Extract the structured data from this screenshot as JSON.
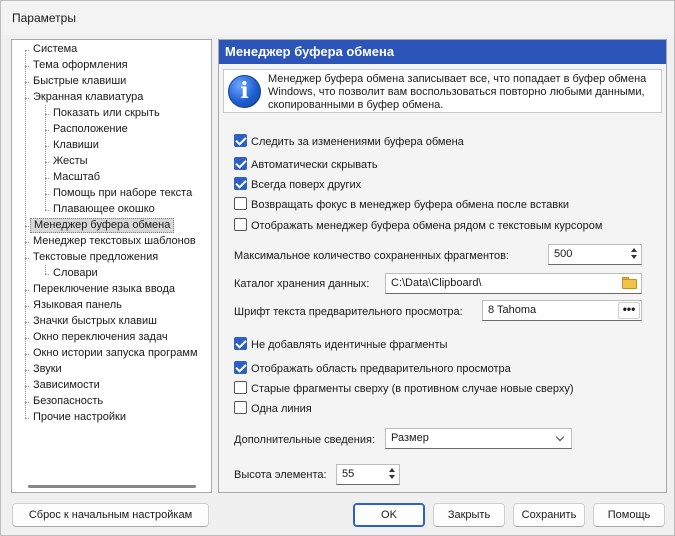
{
  "window": {
    "title": "Параметры"
  },
  "tree": {
    "items": [
      {
        "label": "Система",
        "level": 0
      },
      {
        "label": "Тема оформления",
        "level": 0
      },
      {
        "label": "Быстрые клавиши",
        "level": 0
      },
      {
        "label": "Экранная клавиатура",
        "level": 0
      },
      {
        "label": "Показать или скрыть",
        "level": 1
      },
      {
        "label": "Расположение",
        "level": 1
      },
      {
        "label": "Клавиши",
        "level": 1
      },
      {
        "label": "Жесты",
        "level": 1
      },
      {
        "label": "Масштаб",
        "level": 1
      },
      {
        "label": "Помощь при наборе текста",
        "level": 1
      },
      {
        "label": "Плавающее окошко",
        "level": 1
      },
      {
        "label": "Менеджер буфера обмена",
        "level": 0,
        "selected": true
      },
      {
        "label": "Менеджер текстовых шаблонов",
        "level": 0
      },
      {
        "label": "Текстовые предложения",
        "level": 0
      },
      {
        "label": "Словари",
        "level": 1
      },
      {
        "label": "Переключение языка ввода",
        "level": 0
      },
      {
        "label": "Языковая панель",
        "level": 0
      },
      {
        "label": "Значки быстрых клавиш",
        "level": 0
      },
      {
        "label": "Окно переключения задач",
        "level": 0
      },
      {
        "label": "Окно истории запуска программ",
        "level": 0
      },
      {
        "label": "Звуки",
        "level": 0
      },
      {
        "label": "Зависимости",
        "level": 0
      },
      {
        "label": "Безопасность",
        "level": 0
      },
      {
        "label": "Прочие настройки",
        "level": 0
      }
    ]
  },
  "panel": {
    "title": "Менеджер буфера обмена",
    "info_icon_glyph": "i",
    "info_text": "Менеджер буфера обмена записывает все, что попадает в буфер обмена Windows, что позволит вам воспользоваться повторно любыми данными, скопированными в буфер обмена.",
    "options_group1": [
      {
        "label": "Следить за изменениями буфера обмена",
        "checked": true
      },
      {
        "label": "Автоматически скрывать",
        "checked": true
      },
      {
        "label": "Всегда поверх других",
        "checked": true
      },
      {
        "label": "Возвращать фокус в менеджер буфера обмена после вставки",
        "checked": false
      },
      {
        "label": "Отображать менеджер буфера обмена рядом с текстовым курсором",
        "checked": false
      }
    ],
    "max_fragments_label": "Максимальное количество сохраненных фрагментов:",
    "max_fragments_value": "500",
    "storage_dir_label": "Каталог хранения данных:",
    "storage_dir_value": "C:\\Data\\Clipboard\\",
    "preview_font_label": "Шрифт текста предварительного просмотра:",
    "preview_font_value": "8 Tahoma",
    "preview_font_button": "•••",
    "options_group2": [
      {
        "label": "Не добавлять идентичные фрагменты",
        "checked": true
      },
      {
        "label": "Отображать область предварительного просмотра",
        "checked": true
      },
      {
        "label": "Старые фрагменты сверху (в противном случае новые сверху)",
        "checked": false
      },
      {
        "label": "Одна линия",
        "checked": false
      }
    ],
    "extra_info_label": "Дополнительные сведения:",
    "extra_info_value": "Размер",
    "item_height_label": "Высота элемента:",
    "item_height_value": "55"
  },
  "buttons": {
    "reset": "Сброс к начальным настройкам",
    "ok": "OK",
    "close": "Закрыть",
    "save": "Сохранить",
    "help": "Помощь"
  },
  "colors": {
    "header_bg": "#2b55b8",
    "checkbox_on": "#2d5fc4"
  }
}
